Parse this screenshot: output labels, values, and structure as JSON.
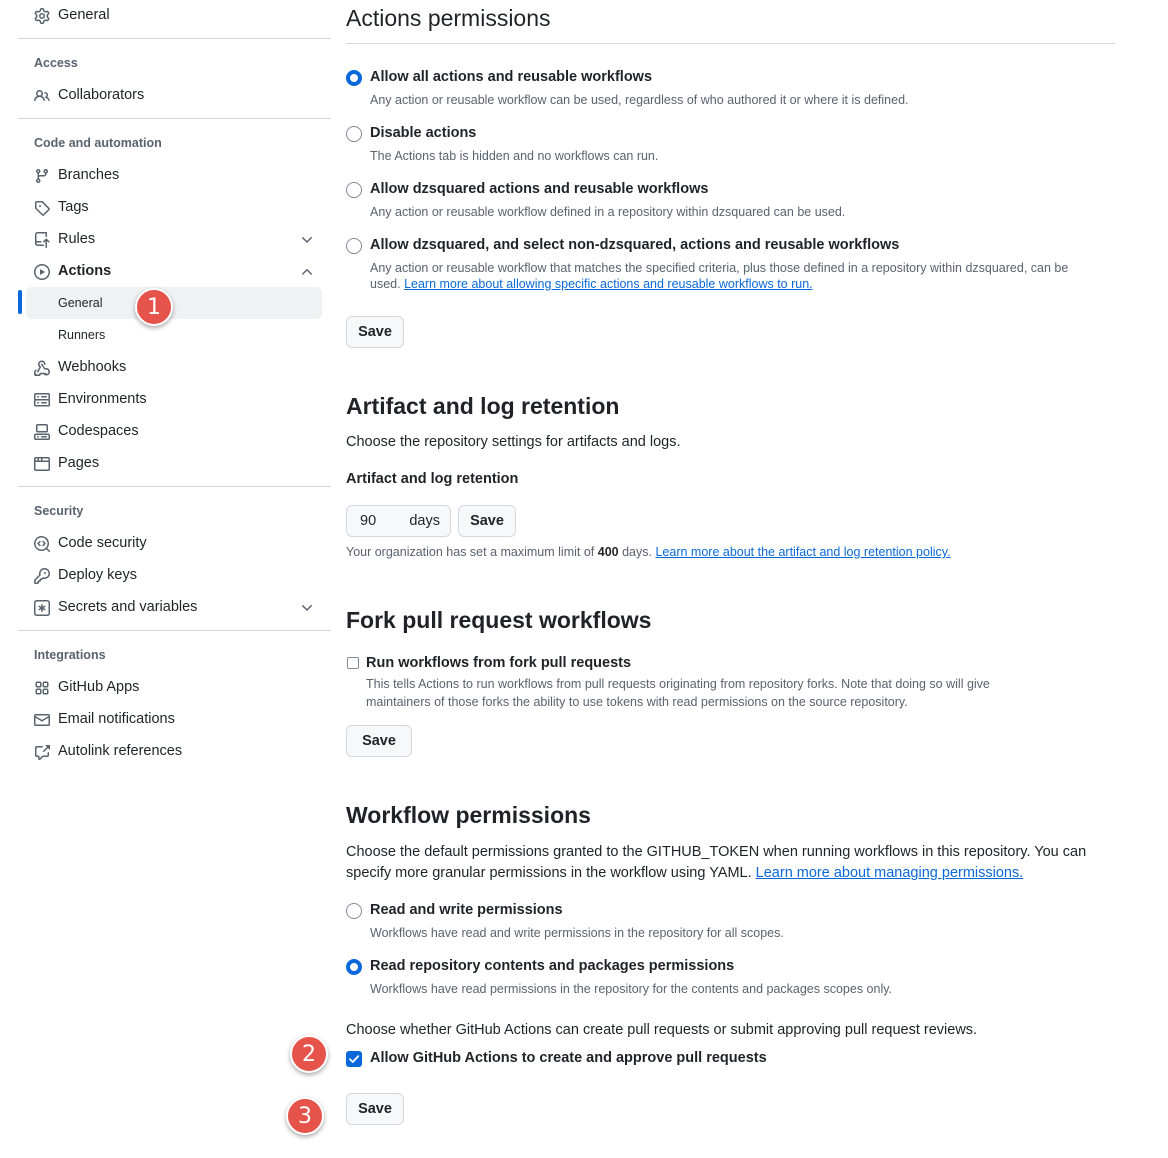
{
  "sidebar": {
    "top_item": {
      "label": "General",
      "icon": "gear-icon"
    },
    "groups": {
      "access": {
        "title": "Access",
        "items": [
          {
            "label": "Collaborators",
            "icon": "people-icon"
          }
        ]
      },
      "code_automation": {
        "title": "Code and automation",
        "items": [
          {
            "label": "Branches",
            "icon": "git-branch-icon"
          },
          {
            "label": "Tags",
            "icon": "tag-icon"
          },
          {
            "label": "Rules",
            "icon": "repo-push-icon",
            "expandable": true
          },
          {
            "label": "Actions",
            "icon": "play-icon",
            "expanded": true
          },
          {
            "label": "Webhooks",
            "icon": "webhook-icon"
          },
          {
            "label": "Environments",
            "icon": "server-icon"
          },
          {
            "label": "Codespaces",
            "icon": "codespaces-icon"
          },
          {
            "label": "Pages",
            "icon": "browser-icon"
          }
        ],
        "actions_sub": [
          {
            "label": "General",
            "active": true
          },
          {
            "label": "Runners"
          }
        ]
      },
      "security": {
        "title": "Security",
        "items": [
          {
            "label": "Code security",
            "icon": "codescan-icon"
          },
          {
            "label": "Deploy keys",
            "icon": "key-icon"
          },
          {
            "label": "Secrets and variables",
            "icon": "key-asterisk-icon",
            "expandable": true
          }
        ]
      },
      "integrations": {
        "title": "Integrations",
        "items": [
          {
            "label": "GitHub Apps",
            "icon": "apps-icon"
          },
          {
            "label": "Email notifications",
            "icon": "mail-icon"
          },
          {
            "label": "Autolink references",
            "icon": "cross-reference-icon"
          }
        ]
      }
    }
  },
  "actions_permissions": {
    "heading": "Actions permissions",
    "options": [
      {
        "title": "Allow all actions and reusable workflows",
        "desc": "Any action or reusable workflow can be used, regardless of who authored it or where it is defined.",
        "checked": true
      },
      {
        "title": "Disable actions",
        "desc": "The Actions tab is hidden and no workflows can run.",
        "checked": false
      },
      {
        "title": "Allow dzsquared actions and reusable workflows",
        "desc": "Any action or reusable workflow defined in a repository within dzsquared can be used.",
        "checked": false
      },
      {
        "title": "Allow dzsquared, and select non-dzsquared, actions and reusable workflows",
        "desc": "Any action or reusable workflow that matches the specified criteria, plus those defined in a repository within dzsquared, can be used.",
        "link": "Learn more about allowing specific actions and reusable workflows to run.",
        "checked": false
      }
    ],
    "save_label": "Save"
  },
  "artifact_retention": {
    "heading": "Artifact and log retention",
    "intro": "Choose the repository settings for artifacts and logs.",
    "field_label": "Artifact and log retention",
    "value": "90",
    "unit": "days",
    "save_label": "Save",
    "note_prefix": "Your organization has set a maximum limit of",
    "note_limit": "400",
    "note_suffix": "days.",
    "note_link": "Learn more about the artifact and log retention policy."
  },
  "fork_pr": {
    "heading": "Fork pull request workflows",
    "checkbox_label": "Run workflows from fork pull requests",
    "checkbox_checked": false,
    "desc": "This tells Actions to run workflows from pull requests originating from repository forks. Note that doing so will give maintainers of those forks the ability to use tokens with read permissions on the source repository.",
    "save_label": "Save"
  },
  "workflow_permissions": {
    "heading": "Workflow permissions",
    "intro": "Choose the default permissions granted to the GITHUB_TOKEN when running workflows in this repository. You can specify more granular permissions in the workflow using YAML.",
    "intro_link": "Learn more about managing permissions.",
    "options": [
      {
        "title": "Read and write permissions",
        "desc": "Workflows have read and write permissions in the repository for all scopes.",
        "checked": false
      },
      {
        "title": "Read repository contents and packages permissions",
        "desc": "Workflows have read permissions in the repository for the contents and packages scopes only.",
        "checked": true
      }
    ],
    "pr_question": "Choose whether GitHub Actions can create pull requests or submit approving pull request reviews.",
    "pr_checkbox_label": "Allow GitHub Actions to create and approve pull requests",
    "pr_checkbox_checked": true,
    "save_label": "Save"
  },
  "markers": [
    "1",
    "2",
    "3"
  ],
  "colors": {
    "accent": "#0969da",
    "marker": "#e5534b",
    "muted": "#59636e"
  }
}
